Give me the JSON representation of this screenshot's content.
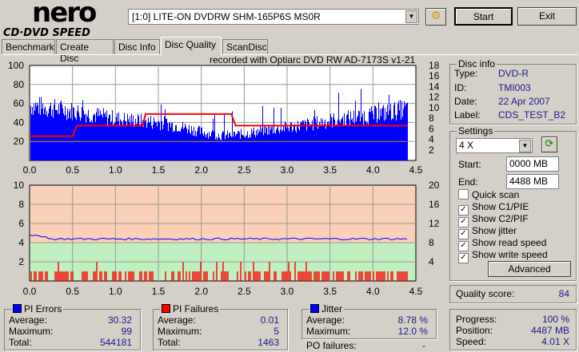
{
  "app": {
    "logo_top": "nero",
    "logo_bottom": "CD·DVD SPEED"
  },
  "toolbar": {
    "drive": "[1:0]  LITE-ON DVDRW SHM-165P6S MS0R",
    "start": "Start",
    "exit": "Exit"
  },
  "tabs": [
    "Benchmark",
    "Create Disc",
    "Disc Info",
    "Disc Quality",
    "ScanDisc"
  ],
  "active_tab": "Disc Quality",
  "recorded_with": "recorded with Optiarc  DVD RW AD-7173S  v1-21",
  "disc_info": {
    "title": "Disc info",
    "type_label": "Type:",
    "type": "DVD-R",
    "id_label": "ID:",
    "id": "TMI003",
    "date_label": "Date:",
    "date": "22 Apr 2007",
    "label_label": "Label:",
    "label": "CDS_TEST_B2"
  },
  "settings": {
    "title": "Settings",
    "speed": "4 X",
    "start_label": "Start:",
    "start": "0000 MB",
    "end_label": "End:",
    "end": "4488 MB",
    "checks": [
      {
        "label": "Quick scan",
        "checked": false
      },
      {
        "label": "Show C1/PIE",
        "checked": true
      },
      {
        "label": "Show C2/PIF",
        "checked": true
      },
      {
        "label": "Show jitter",
        "checked": true
      },
      {
        "label": "Show read speed",
        "checked": true
      },
      {
        "label": "Show write speed",
        "checked": true
      }
    ],
    "advanced": "Advanced"
  },
  "quality": {
    "label": "Quality score:",
    "value": "84"
  },
  "pi_errors": {
    "title": "PI Errors",
    "avg_label": "Average:",
    "avg": "30.32",
    "max_label": "Maximum:",
    "max": "99",
    "total_label": "Total:",
    "total": "544181",
    "color": "#0000ff"
  },
  "pi_failures": {
    "title": "PI Failures",
    "avg_label": "Average:",
    "avg": "0.01",
    "max_label": "Maximum:",
    "max": "5",
    "total_label": "Total:",
    "total": "1463",
    "color": "#ff0000"
  },
  "jitter": {
    "title": "Jitter",
    "avg_label": "Average:",
    "avg": "8.78 %",
    "max_label": "Maximum:",
    "max": "12.0 %",
    "po_label": "PO failures:",
    "po": "-",
    "color": "#0000ff"
  },
  "progress": {
    "progress_label": "Progress:",
    "progress": "100 %",
    "position_label": "Position:",
    "position": "4487 MB",
    "speed_label": "Speed:",
    "speed": "4.01 X"
  },
  "chart_data": [
    {
      "type": "bar",
      "title": "PI Errors",
      "x_ticks": [
        "0.0",
        "0.5",
        "1.0",
        "1.5",
        "2.0",
        "2.5",
        "3.0",
        "3.5",
        "4.0",
        "4.5"
      ],
      "xlim": [
        0,
        4.5
      ],
      "ylim": [
        0,
        100
      ],
      "y_ticks": [
        "100",
        "80",
        "60",
        "40",
        "20"
      ],
      "y2lim": [
        0,
        18
      ],
      "y2_ticks": [
        "18",
        "16",
        "14",
        "12",
        "10",
        "8",
        "6",
        "4",
        "2"
      ],
      "x": [
        0,
        0.25,
        0.5,
        0.75,
        1.0,
        1.25,
        1.5,
        1.75,
        2.0,
        2.25,
        2.5,
        2.75,
        3.0,
        3.25,
        3.5,
        3.75,
        4.0,
        4.25,
        4.4
      ],
      "pie": [
        58,
        55,
        52,
        48,
        44,
        42,
        40,
        36,
        30,
        26,
        28,
        32,
        35,
        38,
        42,
        45,
        48,
        52,
        55
      ],
      "read_speed_x": [
        0,
        0.5,
        0.55,
        1.32,
        1.35,
        2.35,
        2.4,
        4.4
      ],
      "read_speed": [
        4.6,
        4.6,
        6.6,
        6.6,
        8.8,
        8.8,
        6.6,
        6.6
      ]
    },
    {
      "type": "bar",
      "title": "PI Failures / Jitter",
      "xlim": [
        0,
        4.5
      ],
      "ylim": [
        0,
        10
      ],
      "y_ticks": [
        "10",
        "8",
        "6",
        "4",
        "2"
      ],
      "y2lim": [
        0,
        20
      ],
      "y2_ticks": [
        "20",
        "16",
        "12",
        "8",
        "4"
      ],
      "x_ticks": [
        "0.0",
        "0.5",
        "1.0",
        "1.5",
        "2.0",
        "2.5",
        "3.0",
        "3.5",
        "4.0",
        "4.5"
      ],
      "jitter_avg": 8.78,
      "pif_max": 5
    }
  ]
}
